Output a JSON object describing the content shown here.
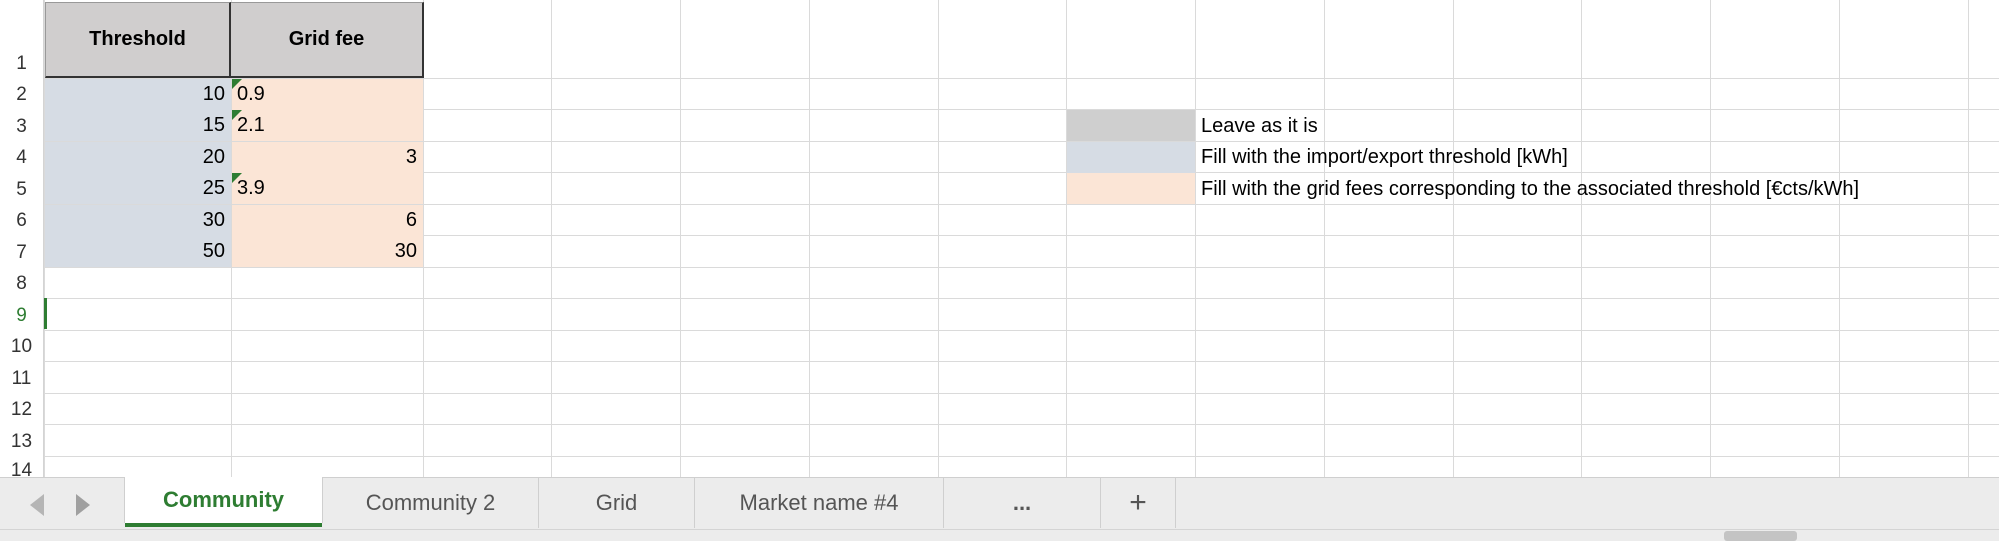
{
  "sheet": {
    "headers": {
      "threshold": "Threshold",
      "grid_fee": "Grid fee"
    },
    "rows": [
      {
        "threshold": "10",
        "fee": "0.9"
      },
      {
        "threshold": "15",
        "fee": "2.1"
      },
      {
        "threshold": "20",
        "fee": "3"
      },
      {
        "threshold": "25",
        "fee": "3.9"
      },
      {
        "threshold": "30",
        "fee": "6"
      },
      {
        "threshold": "50",
        "fee": "30"
      }
    ],
    "row_numbers": [
      "1",
      "2",
      "3",
      "4",
      "5",
      "6",
      "7",
      "8",
      "9",
      "10",
      "11",
      "12",
      "13",
      "14"
    ],
    "active_row": "9"
  },
  "legend": {
    "leave": "Leave as it is",
    "threshold": "Fill with the import/export threshold [kWh]",
    "fees": "Fill with the grid fees corresponding to the associated threshold [€cts/kWh]"
  },
  "tabs": [
    "Community",
    "Community 2",
    "Grid",
    "Market name #4",
    "...",
    "+"
  ],
  "active_tab": "Community",
  "colors": {
    "header_gray": "#d0cece",
    "threshold_blue": "#d6dce4",
    "fee_peach": "#fbe5d6",
    "accent_green": "#2e7d32"
  },
  "icons": {
    "prev_sheet": "triangle-left-icon",
    "next_sheet": "triangle-right-icon",
    "add_sheet": "plus-icon",
    "comment_indicator": "green-corner-triangle"
  }
}
